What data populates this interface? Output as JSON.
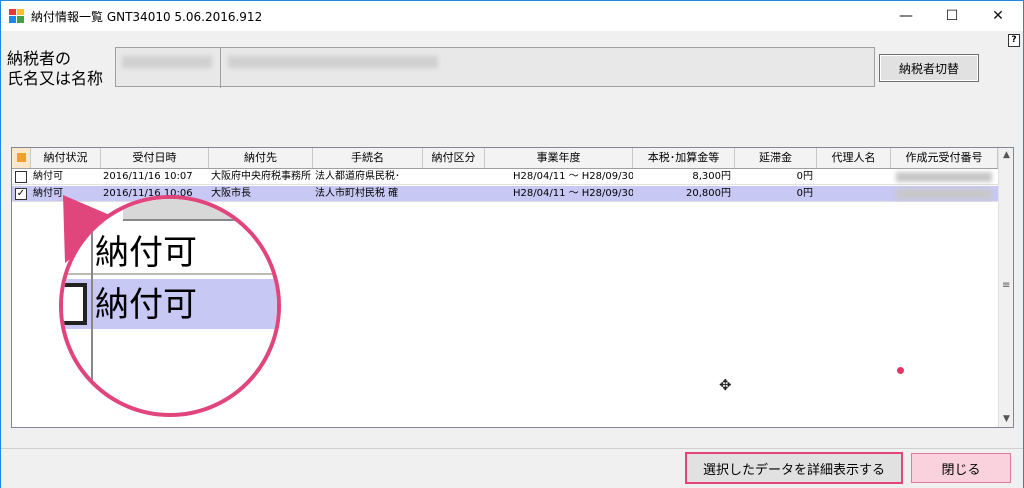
{
  "window": {
    "title": "納付情報一覧 GNT34010  5.06.2016.912",
    "min_glyph": "—",
    "max_glyph": "☐",
    "close_glyph": "✕"
  },
  "help_glyph": "?",
  "taxpayer": {
    "label_line1": "納税者の",
    "label_line2": "氏名又は名称",
    "switch_button": "納税者切替"
  },
  "grid": {
    "columns": [
      "納付状況",
      "受付日時",
      "納付先",
      "手続名",
      "納付区分",
      "事業年度",
      "本税･加算金等",
      "延滞金",
      "代理人名",
      "作成元受付番号"
    ],
    "rows": [
      {
        "checked": false,
        "status": "納付可",
        "received": "2016/11/16 10:07",
        "payee": "大阪府中央府税事務所",
        "procedure": "法人都道府県民税･",
        "category": "",
        "fiscal_year": "H28/04/11 ～ H28/09/30",
        "amount": "8,300円",
        "late_fee": "0円",
        "agent": ""
      },
      {
        "checked": true,
        "status": "納付可",
        "received": "2016/11/16 10:06",
        "payee": "大阪市長",
        "procedure": "法人市町村民税 確",
        "category": "",
        "fiscal_year": "H28/04/11 ～ H28/09/30",
        "amount": "20,800円",
        "late_fee": "0円",
        "agent": ""
      }
    ]
  },
  "zoom": {
    "row1_text": "納付可",
    "row2_text": "納付可"
  },
  "buttons": {
    "detail": "選択したデータを詳細表示する",
    "close": "閉じる"
  },
  "checkbox_checked_glyph": "✓",
  "colors": {
    "accent_pink": "#e0457b",
    "selected_row": "#c8c8f4",
    "window_border": "#1e88e5"
  },
  "icons": {
    "cursor": "move-cursor-icon"
  }
}
